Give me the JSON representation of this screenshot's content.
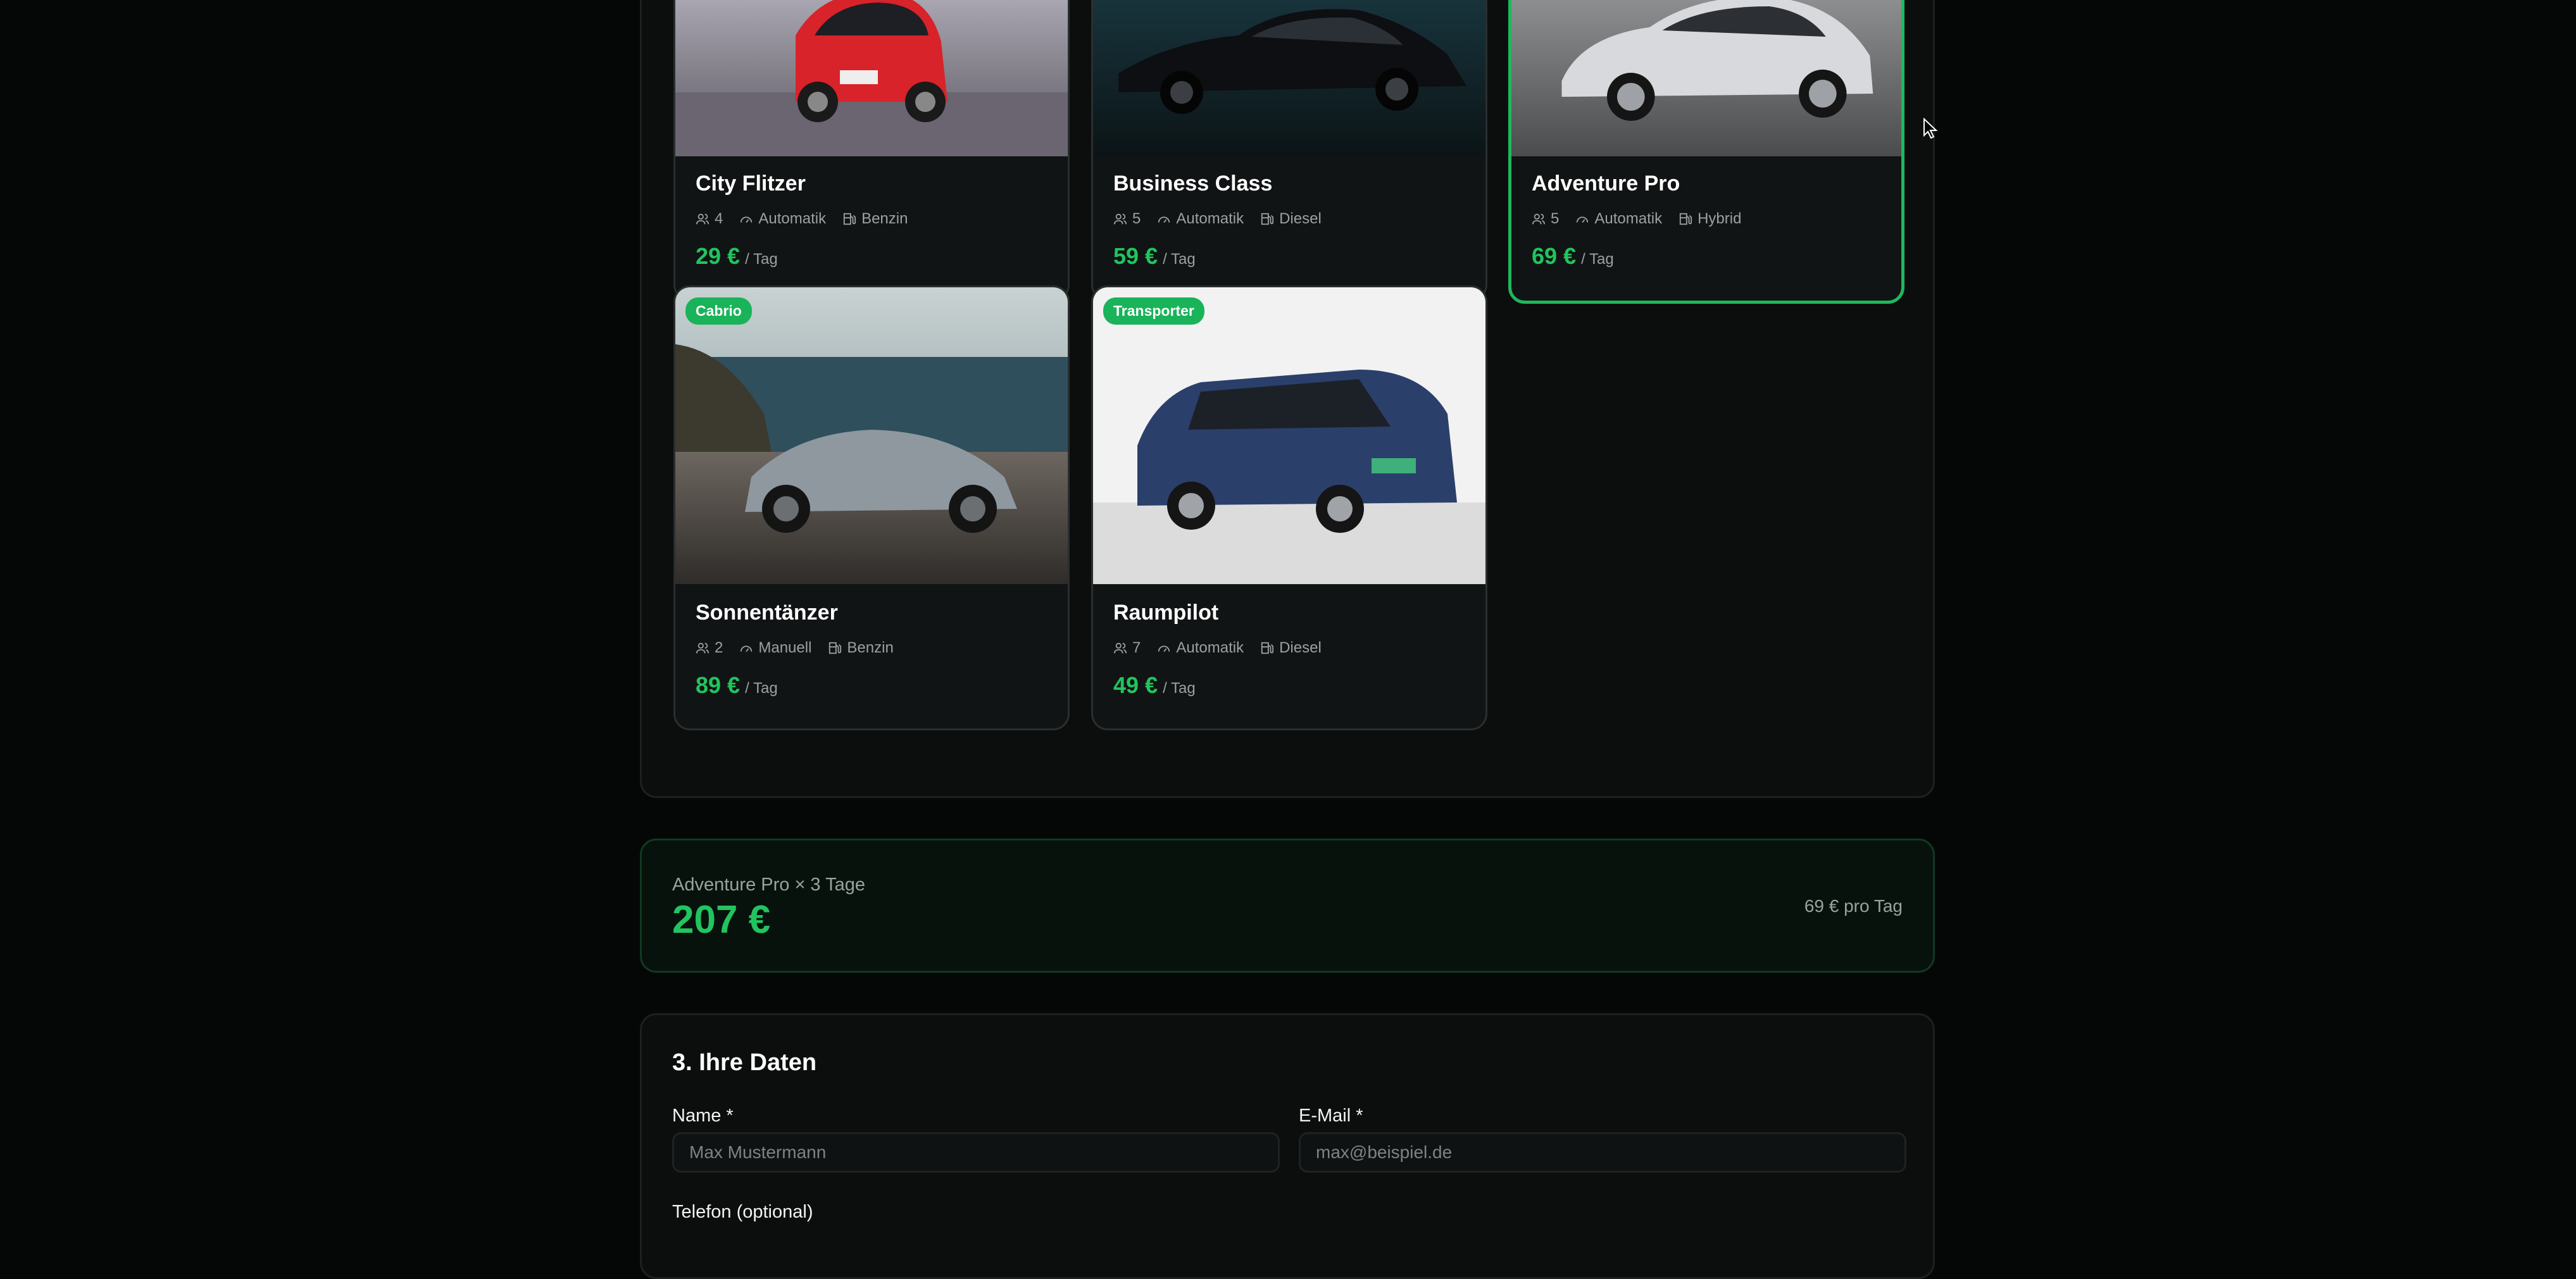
{
  "vehicles": [
    {
      "name": "City Flitzer",
      "seats": "4",
      "transmission": "Automatik",
      "fuel": "Benzin",
      "price": "29 €",
      "per": "/ Tag",
      "badge": "",
      "selected": false,
      "body_color": "#d8232a"
    },
    {
      "name": "Business Class",
      "seats": "5",
      "transmission": "Automatik",
      "fuel": "Diesel",
      "price": "59 €",
      "per": "/ Tag",
      "badge": "",
      "selected": false,
      "body_color": "#0d0f12"
    },
    {
      "name": "Adventure Pro",
      "seats": "5",
      "transmission": "Automatik",
      "fuel": "Hybrid",
      "price": "69 €",
      "per": "/ Tag",
      "badge": "",
      "selected": true,
      "body_color": "#d7d9dc"
    },
    {
      "name": "Sonnentänzer",
      "seats": "2",
      "transmission": "Manuell",
      "fuel": "Benzin",
      "price": "89 €",
      "per": "/ Tag",
      "badge": "Cabrio",
      "selected": false,
      "body_color": "#8f989e"
    },
    {
      "name": "Raumpilot",
      "seats": "7",
      "transmission": "Automatik",
      "fuel": "Diesel",
      "price": "49 €",
      "per": "/ Tag",
      "badge": "Transporter",
      "selected": false,
      "body_color": "#2b3f6b"
    }
  ],
  "summary": {
    "label": "Adventure Pro × 3 Tage",
    "total": "207 €",
    "rate": "69 € pro Tag"
  },
  "details": {
    "title": "3. Ihre Daten",
    "name_label": "Name *",
    "name_placeholder": "Max Mustermann",
    "email_label": "E-Mail *",
    "email_placeholder": "max@beispiel.de",
    "phone_label": "Telefon (optional)"
  },
  "colors": {
    "accent": "#21c45e",
    "background": "#050707",
    "card": "#111414"
  },
  "icons": {
    "seats": "users-icon",
    "transmission": "gauge-icon",
    "fuel": "fuel-pump-icon",
    "cursor": "mouse-pointer-icon"
  }
}
